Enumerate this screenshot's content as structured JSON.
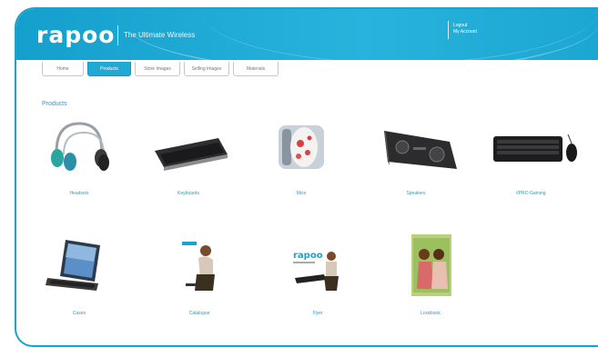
{
  "header": {
    "logo": "rapoo",
    "tagline": "The Ultimate Wireless",
    "account_lines": [
      "Logout",
      "My Account"
    ]
  },
  "tabs": [
    {
      "label": "Home",
      "active": false
    },
    {
      "label": "Products",
      "active": true
    },
    {
      "label": "Store Images",
      "active": false
    },
    {
      "label": "Selling Images",
      "active": false
    },
    {
      "label": "Materials",
      "active": false
    }
  ],
  "section": {
    "title": "Products"
  },
  "products": [
    {
      "label": "Headsets",
      "icon": "headset-icon"
    },
    {
      "label": "Keyboards",
      "icon": "keyboard-icon"
    },
    {
      "label": "Mice",
      "icon": "mouse-icon"
    },
    {
      "label": "Speakers",
      "icon": "speaker-icon"
    },
    {
      "label": "VPRO Gaming",
      "icon": "gaming-keyboard-icon"
    },
    {
      "label": "Cases",
      "icon": "tablet-case-icon"
    },
    {
      "label": "Catalogue",
      "icon": "catalogue-icon"
    },
    {
      "label": "Flyer",
      "icon": "flyer-icon"
    },
    {
      "label": "Lookbook",
      "icon": "lookbook-icon"
    }
  ],
  "colors": {
    "brand": "#1aa3cc",
    "link": "#2a9cc8"
  }
}
